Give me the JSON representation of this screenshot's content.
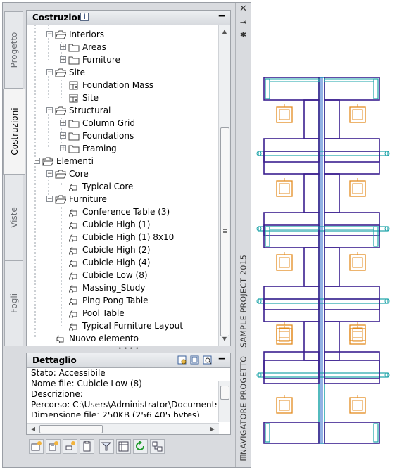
{
  "palette_title": "NAVIGATORE PROGETTO - SAMPLE PROJECT 2015",
  "tabs": [
    {
      "label": "Progetto",
      "active": false
    },
    {
      "label": "Costruzioni",
      "active": true
    },
    {
      "label": "Viste",
      "active": false
    },
    {
      "label": "Fogli",
      "active": false
    }
  ],
  "tree_panel": {
    "title": "Costruzioni",
    "info_icon": "i",
    "minimize": "−",
    "items": [
      {
        "label": "Interiors",
        "expander": "−",
        "icon": "folder-open-icon"
      },
      {
        "label": "Areas",
        "expander": "+",
        "icon": "folder-icon"
      },
      {
        "label": "Furniture",
        "expander": "+",
        "icon": "folder-icon"
      },
      {
        "label": "Site",
        "expander": "−",
        "icon": "folder-open-icon"
      },
      {
        "label": "Foundation Mass",
        "expander": "",
        "icon": "building-element-icon"
      },
      {
        "label": "Site",
        "expander": "",
        "icon": "building-element-icon"
      },
      {
        "label": "Structural",
        "expander": "−",
        "icon": "folder-open-icon"
      },
      {
        "label": "Column Grid",
        "expander": "+",
        "icon": "folder-icon"
      },
      {
        "label": "Foundations",
        "expander": "+",
        "icon": "folder-icon"
      },
      {
        "label": "Framing",
        "expander": "+",
        "icon": "folder-icon"
      },
      {
        "label": "Elementi",
        "expander": "−",
        "icon": "folder-open-icon"
      },
      {
        "label": "Core",
        "expander": "−",
        "icon": "folder-open-icon"
      },
      {
        "label": "Typical Core",
        "expander": "",
        "icon": "element-icon"
      },
      {
        "label": "Furniture",
        "expander": "−",
        "icon": "folder-open-icon"
      },
      {
        "label": "Conference Table (3)",
        "expander": "",
        "icon": "element-icon"
      },
      {
        "label": "Cubicle High (1)",
        "expander": "",
        "icon": "element-icon"
      },
      {
        "label": "Cubicle High (1) 8x10",
        "expander": "",
        "icon": "element-icon"
      },
      {
        "label": "Cubicle High (2)",
        "expander": "",
        "icon": "element-icon"
      },
      {
        "label": "Cubicle High (4)",
        "expander": "",
        "icon": "element-icon"
      },
      {
        "label": "Cubicle Low (8)",
        "expander": "",
        "icon": "element-icon"
      },
      {
        "label": "Massing_Study",
        "expander": "",
        "icon": "element-icon"
      },
      {
        "label": "Ping Pong Table",
        "expander": "",
        "icon": "element-icon"
      },
      {
        "label": "Pool Table",
        "expander": "",
        "icon": "element-icon"
      },
      {
        "label": "Typical Furniture Layout",
        "expander": "",
        "icon": "element-icon"
      },
      {
        "label": "Nuovo elemento",
        "expander": "",
        "icon": "element-icon"
      }
    ]
  },
  "detail_panel": {
    "title": "Dettaglio",
    "minimize": "−",
    "lines": [
      "Stato: Accessibile",
      "Nome file: Cubicle Low (8)",
      "Descrizione:",
      "Percorso: C:\\Users\\Administrator\\Documents\\Aut",
      "Dimensione file: 250KB (256,405 bytes)"
    ]
  },
  "toolbar_icons": [
    "add-construct-icon",
    "add-element-icon",
    "new-element-icon",
    "clipboard-icon",
    "filter-icon",
    "table-icon",
    "refresh-icon",
    "repath-icon"
  ],
  "colors": {
    "cubicle_purple": "#3b1f8f",
    "cubicle_teal": "#1aa3a8",
    "chair_orange": "#e38b1f",
    "wall_blue": "#2566c9"
  }
}
